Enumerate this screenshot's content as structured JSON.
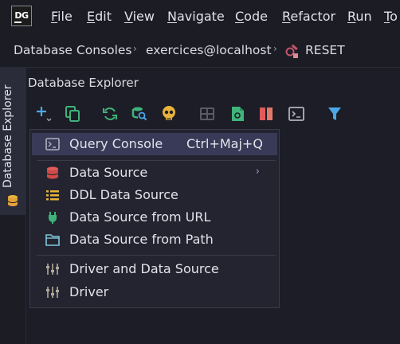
{
  "app": {
    "logo_text": "DG"
  },
  "menubar": {
    "items": [
      {
        "underlined": "F",
        "rest": "ile"
      },
      {
        "underlined": "E",
        "rest": "dit"
      },
      {
        "underlined": "V",
        "rest": "iew"
      },
      {
        "underlined": "N",
        "rest": "avigate"
      },
      {
        "underlined": "C",
        "rest": "ode"
      },
      {
        "underlined": "R",
        "rest": "efactor"
      },
      {
        "underlined": "R",
        "rest": "un"
      },
      {
        "underlined": "T",
        "rest": "o"
      }
    ]
  },
  "breadcrumb": {
    "items": [
      "Database Consoles",
      "exercices@localhost",
      "RESET"
    ],
    "separator": "›"
  },
  "sidebar": {
    "tab_label": "Database Explorer"
  },
  "panel": {
    "title": "Database Explorer"
  },
  "toolbar": {
    "icons": [
      "add-icon",
      "copy-icon",
      "refresh-icon",
      "schema-search-icon",
      "skull-icon",
      "table-icon",
      "export-icon",
      "compare-icon",
      "console-icon",
      "filter-icon"
    ]
  },
  "dropdown": {
    "items": [
      {
        "label": "Query Console",
        "shortcut": "Ctrl+Maj+Q",
        "icon": "console-icon",
        "selected": true
      },
      {
        "label": "Data Source",
        "icon": "database-icon",
        "submenu": true
      },
      {
        "label": "DDL Data Source",
        "icon": "ddl-list-icon"
      },
      {
        "label": "Data Source from URL",
        "icon": "plug-icon"
      },
      {
        "label": "Data Source from Path",
        "icon": "folder-icon"
      },
      {
        "label": "Driver and Data Source",
        "icon": "driver-sliders-icon"
      },
      {
        "label": "Driver",
        "icon": "driver-sliders-icon"
      }
    ],
    "submenu_arrow": "›"
  },
  "colors": {
    "background": "#1c1d26",
    "selection": "#383a57",
    "accent_blue": "#4aa8e8",
    "accent_green": "#3fb37a",
    "accent_red": "#e05a5a",
    "accent_yellow": "#e8b33a"
  }
}
